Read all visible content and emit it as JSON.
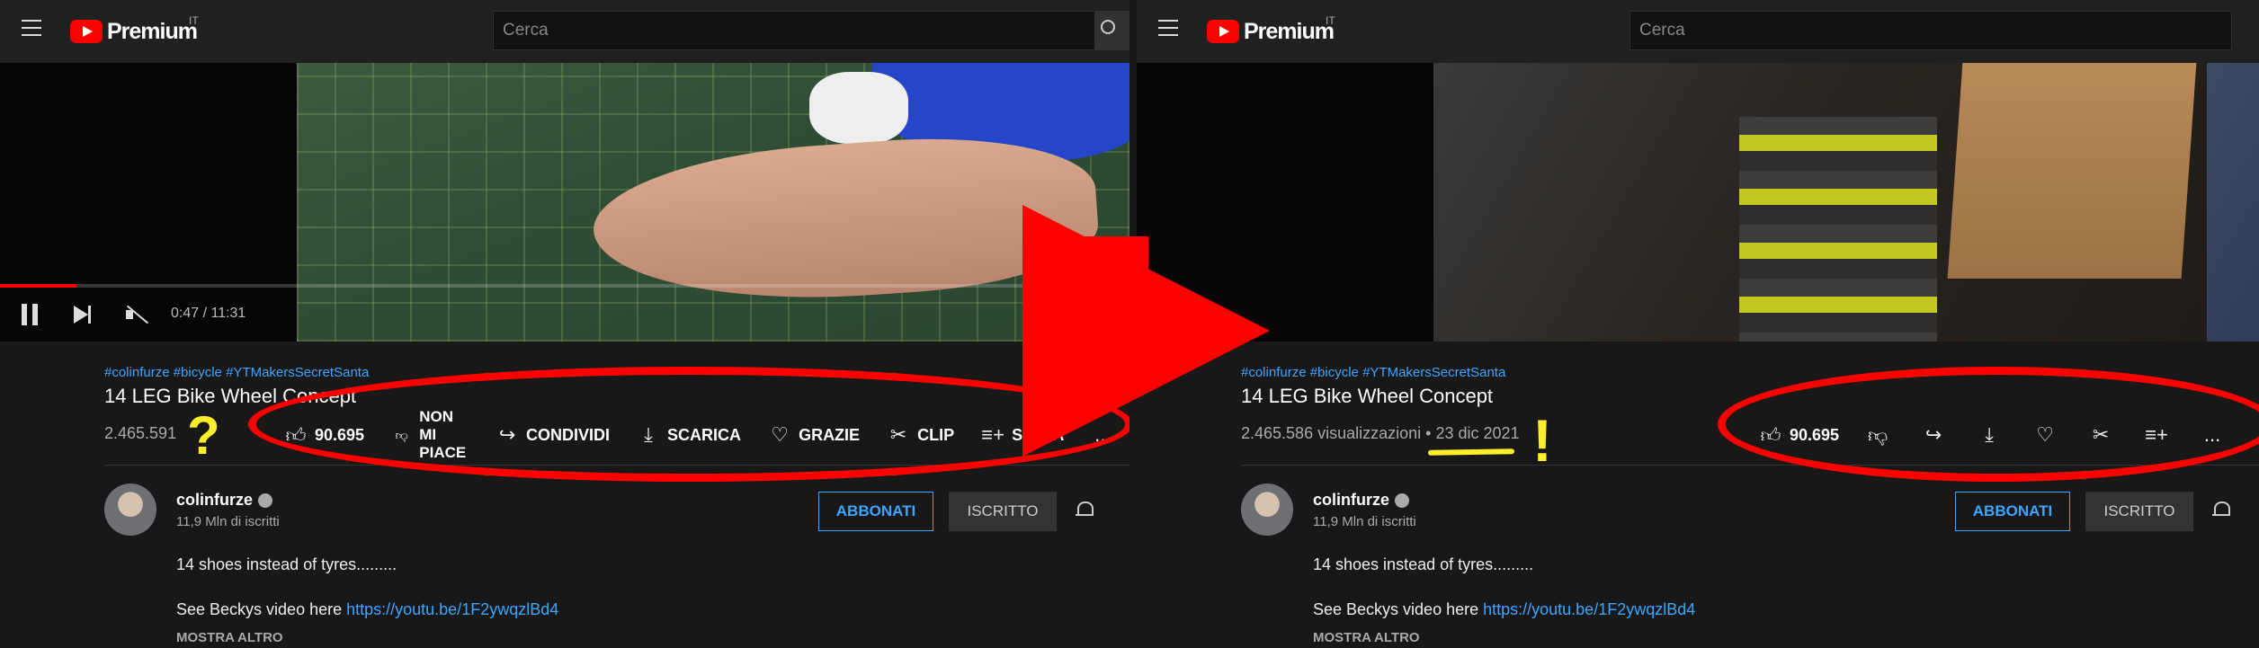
{
  "search": {
    "placeholder": "Cerca"
  },
  "logo": {
    "word": "Premium",
    "region": "IT"
  },
  "video": {
    "time": "0:47 / 11:31",
    "progress": 0.068
  },
  "left": {
    "tags": "#colinfurze #bicycle #YTMakersSecretSanta",
    "title": "14 LEG Bike Wheel Concept",
    "views": "2.465.591",
    "actions": {
      "like": "90.695",
      "dislike_line1": "NON MI",
      "dislike_line2": "PIACE",
      "share": "CONDIVIDI",
      "download": "SCARICA",
      "thanks": "GRAZIE",
      "clip": "CLIP",
      "save": "SALVA",
      "more": "..."
    },
    "annotation": "?"
  },
  "right": {
    "tags": "#colinfurze #bicycle #YTMakersSecretSanta",
    "title": "14 LEG Bike Wheel Concept",
    "views": "2.465.586 visualizzazioni",
    "separator": "•",
    "date": "23 dic 2021",
    "actions": {
      "like": "90.695",
      "more": "..."
    },
    "annotation": "!"
  },
  "channel": {
    "name": "colinfurze",
    "subscribers": "11,9 Mln di iscritti",
    "subscribe_label": "ABBONATI",
    "subscribed_label": "ISCRITTO"
  },
  "description": {
    "line1": "14 shoes instead of tyres.........",
    "line2_prefix": "See Beckys video here ",
    "link": "https://youtu.be/1F2ywqzlBd4",
    "show_more": "MOSTRA ALTRO"
  },
  "colors": {
    "accent": "#3ea6ff",
    "annotation_red": "#ff0000",
    "annotation_yellow": "#ffef2a"
  }
}
